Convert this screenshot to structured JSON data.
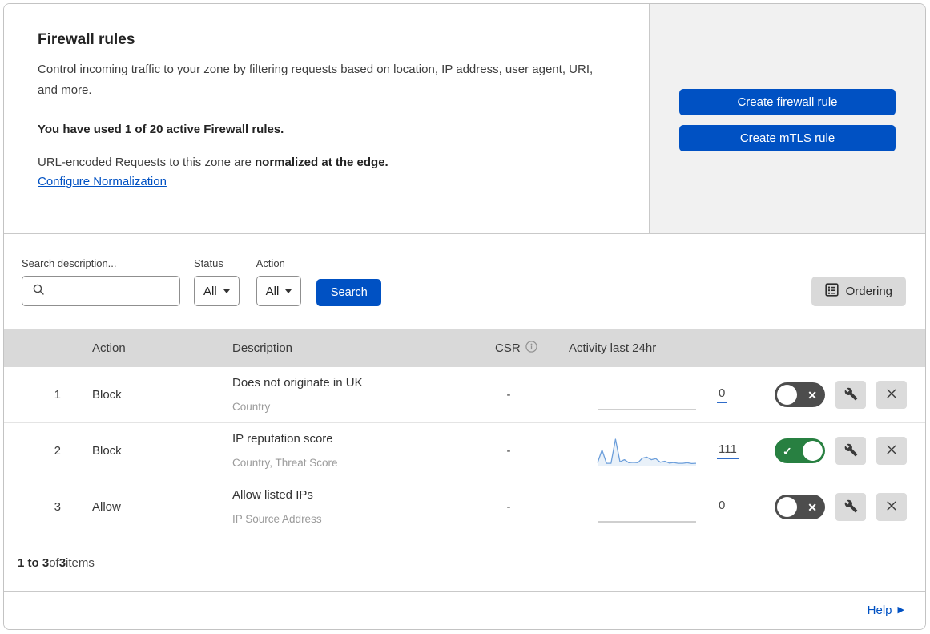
{
  "header": {
    "title": "Firewall rules",
    "description": "Control incoming traffic to your zone by filtering requests based on location, IP address, user agent, URI, and more.",
    "usage_bold": "You have used 1 of 20 active Firewall rules.",
    "normalization_prefix": "URL-encoded Requests to this zone are ",
    "normalization_bold": "normalized at the edge.",
    "normalization_link": "Configure Normalization",
    "buttons": [
      {
        "label": "Create firewall rule"
      },
      {
        "label": "Create mTLS rule"
      }
    ]
  },
  "filters": {
    "search_label": "Search description...",
    "search_value": "",
    "status_label": "Status",
    "status_value": "All",
    "action_label": "Action",
    "action_value": "All",
    "search_button": "Search",
    "ordering_button": "Ordering"
  },
  "table": {
    "columns": {
      "action": "Action",
      "description": "Description",
      "csr": "CSR",
      "activity": "Activity last 24hr"
    },
    "rows": [
      {
        "priority": "1",
        "action": "Block",
        "description": "Does not originate in UK",
        "fields": "Country",
        "csr": "-",
        "activity_count": "0",
        "enabled": false,
        "sparkline": []
      },
      {
        "priority": "2",
        "action": "Block",
        "description": "IP reputation score",
        "fields": "Country, Threat Score",
        "csr": "-",
        "activity_count": "111",
        "enabled": true,
        "sparkline": [
          8,
          58,
          6,
          6,
          100,
          12,
          20,
          8,
          10,
          8,
          26,
          30,
          20,
          24,
          10,
          14,
          7,
          9,
          6,
          6,
          8,
          5,
          6
        ]
      },
      {
        "priority": "3",
        "action": "Allow",
        "description": "Allow listed IPs",
        "fields": "IP Source Address",
        "csr": "-",
        "activity_count": "0",
        "enabled": false,
        "sparkline": []
      }
    ]
  },
  "pagination": {
    "range_bold": "1 to 3",
    "of_text": " of ",
    "total_bold": "3",
    "items_text": " items"
  },
  "footer": {
    "help_label": "Help"
  },
  "colors": {
    "accent_blue": "#0051c3",
    "toggle_on_green": "#288041",
    "toggle_off_gray": "#4d4d4d",
    "sparkline_blue": "#6d9fdb",
    "sparkline_fill": "rgba(110,159,214,0.15)",
    "flat_line_gray": "#bfbfbf",
    "panel_gray": "#f1f1f1",
    "table_header_gray": "#d9d9d9"
  }
}
